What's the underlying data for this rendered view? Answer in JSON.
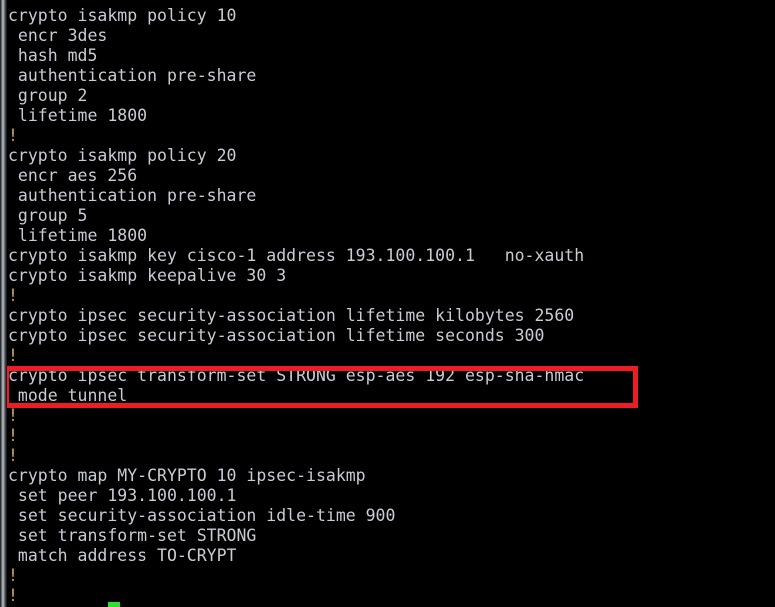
{
  "terminal": {
    "title": "Cisco IOS crypto configuration",
    "background_color": "#000000",
    "text_color": "#c8ccd4",
    "comment_color": "#caa75c",
    "highlight_color": "#ee1c25",
    "marker_color": "#2ee02e",
    "partial_top_line": "!",
    "lines": [
      {
        "text": "crypto isakmp policy 10",
        "kind": "command"
      },
      {
        "text": " encr 3des",
        "kind": "command"
      },
      {
        "text": " hash md5",
        "kind": "command"
      },
      {
        "text": " authentication pre-share",
        "kind": "command"
      },
      {
        "text": " group 2",
        "kind": "command"
      },
      {
        "text": " lifetime 1800",
        "kind": "command"
      },
      {
        "text": "!",
        "kind": "comment"
      },
      {
        "text": "crypto isakmp policy 20",
        "kind": "command"
      },
      {
        "text": " encr aes 256",
        "kind": "command"
      },
      {
        "text": " authentication pre-share",
        "kind": "command"
      },
      {
        "text": " group 5",
        "kind": "command"
      },
      {
        "text": " lifetime 1800",
        "kind": "command"
      },
      {
        "text": "crypto isakmp key cisco-1 address 193.100.100.1   no-xauth",
        "kind": "command"
      },
      {
        "text": "crypto isakmp keepalive 30 3",
        "kind": "command"
      },
      {
        "text": "!",
        "kind": "comment"
      },
      {
        "text": "crypto ipsec security-association lifetime kilobytes 2560",
        "kind": "command"
      },
      {
        "text": "crypto ipsec security-association lifetime seconds 300",
        "kind": "command"
      },
      {
        "text": "!",
        "kind": "comment"
      },
      {
        "text": "crypto ipsec transform-set STRONG esp-aes 192 esp-sha-hmac",
        "kind": "command"
      },
      {
        "text": " mode tunnel",
        "kind": "command"
      },
      {
        "text": "!",
        "kind": "comment"
      },
      {
        "text": "!",
        "kind": "comment"
      },
      {
        "text": "!",
        "kind": "comment"
      },
      {
        "text": "crypto map MY-CRYPTO 10 ipsec-isakmp",
        "kind": "command"
      },
      {
        "text": " set peer 193.100.100.1",
        "kind": "command"
      },
      {
        "text": " set security-association idle-time 900",
        "kind": "command"
      },
      {
        "text": " set transform-set STRONG",
        "kind": "command"
      },
      {
        "text": " match address TO-CRYPT",
        "kind": "command"
      },
      {
        "text": "!",
        "kind": "comment"
      },
      {
        "text": "!",
        "kind": "comment"
      }
    ]
  }
}
